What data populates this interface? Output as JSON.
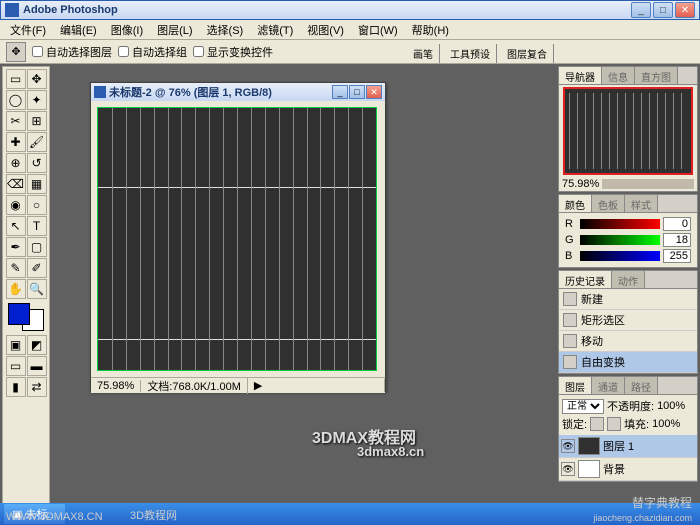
{
  "app": {
    "title": "Adobe Photoshop"
  },
  "menu": [
    "文件(F)",
    "编辑(E)",
    "图像(I)",
    "图层(L)",
    "选择(S)",
    "滤镜(T)",
    "视图(V)",
    "窗口(W)",
    "帮助(H)"
  ],
  "options": {
    "auto_select_layer": "自动选择图层",
    "auto_select_group": "自动选择组",
    "show_transform": "显示变换控件"
  },
  "opt_panels": [
    "画笔",
    "工具预设",
    "图层复合"
  ],
  "doc": {
    "title": "未标题-2 @ 76% (图层 1, RGB/8)",
    "zoom": "75.98%",
    "filesize": "文档:768.0K/1.00M"
  },
  "navigator": {
    "tabs": [
      "导航器",
      "信息",
      "直方图"
    ],
    "zoom": "75.98%"
  },
  "color": {
    "tabs": [
      "颜色",
      "色板",
      "样式"
    ],
    "r": "0",
    "g": "18",
    "b": "255"
  },
  "history": {
    "tabs": [
      "历史记录",
      "动作"
    ],
    "items": [
      "新建",
      "矩形选区",
      "移动",
      "自由变换"
    ]
  },
  "layers": {
    "tabs": [
      "图层",
      "通道",
      "路径"
    ],
    "mode": "正常",
    "opacity_label": "不透明度:",
    "opacity": "100%",
    "lock_label": "锁定:",
    "fill_label": "填充:",
    "fill": "100%",
    "items": [
      "图层 1",
      "背景"
    ]
  },
  "taskbar": {
    "item": "未标..."
  },
  "watermarks": {
    "w1": "3DMAX教程网",
    "w2": "3dmax8.cn",
    "url": "WWW.3DMAX8.CN",
    "brand": "3D教程网",
    "right1": "替字典教程",
    "right2": "jiaocheng.chazidian.com"
  },
  "colors": {
    "fg": "#0020d0",
    "bg": "#ffffff"
  }
}
